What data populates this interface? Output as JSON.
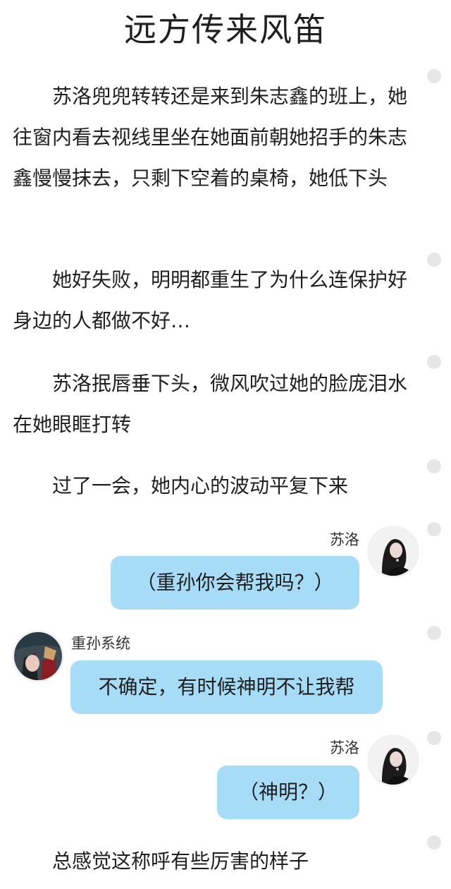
{
  "title": "远方传来风笛",
  "paragraphs": [
    "苏洛兜兜转转还是来到朱志鑫的班上，她往窗内看去视线里坐在她面前朝她招手的朱志鑫慢慢抹去，只剩下空着的桌椅，她低下头",
    "她好失败，明明都重生了为什么连保护好身边的人都做不好…",
    "苏洛抿唇垂下头，微风吹过她的脸庞泪水在她眼眶打转",
    "过了一会，她内心的波动平复下来"
  ],
  "chat": [
    {
      "speaker": "苏洛",
      "text": "（重孙你会帮我吗？）"
    },
    {
      "speaker": "重孙系统",
      "text": "不确定，有时候神明不让我帮"
    },
    {
      "speaker": "苏洛",
      "text": "（神明？）"
    }
  ],
  "closing": "总感觉这称呼有些厉害的样子",
  "colors": {
    "bubble": "#a7dcf7",
    "dot": "#e6e6e6",
    "text": "#1f1f1f"
  }
}
